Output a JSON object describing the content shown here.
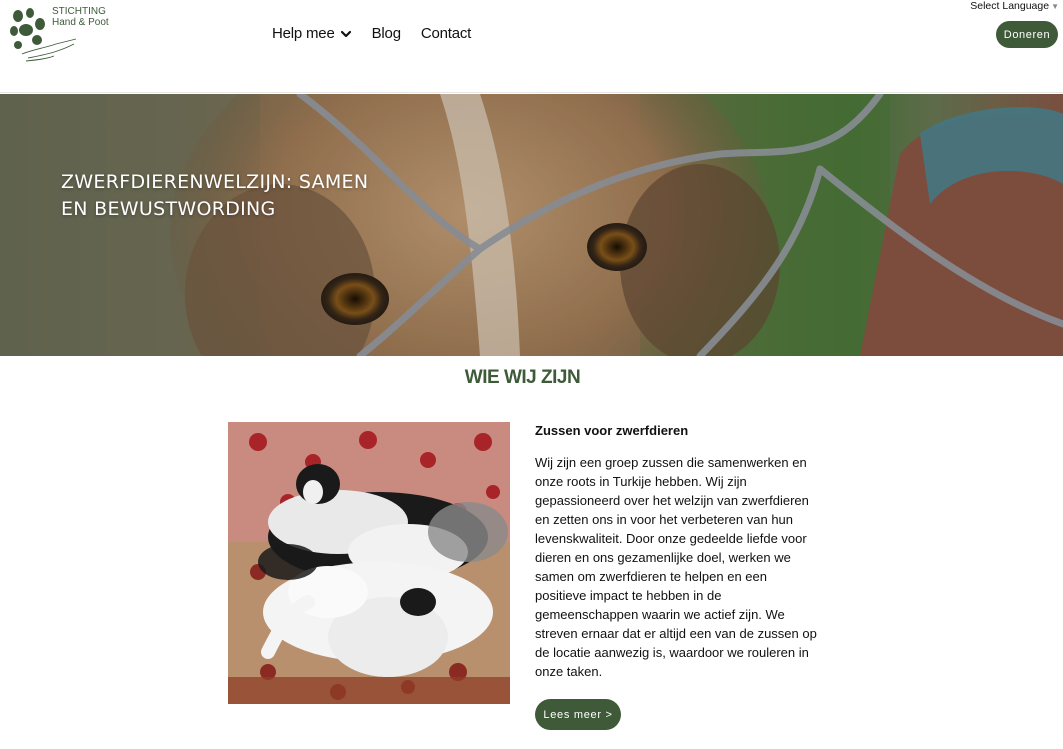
{
  "header": {
    "logo_line1": "STICHTING",
    "logo_line2": "Hand & Poot",
    "nav": [
      {
        "label": "Help mee",
        "has_dropdown": true
      },
      {
        "label": "Blog"
      },
      {
        "label": "Contact"
      }
    ],
    "language_select": "Select Language",
    "donate_label": "Doneren"
  },
  "hero": {
    "title": "ZWERFDIERENWELZIJN: SAMEN EN BEWUSTWORDING"
  },
  "about": {
    "section_title": "WIE WIJ ZIJN",
    "subheading": "Zussen voor zwerfdieren",
    "body": "Wij zijn een groep zussen die samenwerken en onze roots in Turkije hebben. Wij zijn gepassioneerd over het welzijn van zwerfdieren en zetten ons in voor het verbeteren van hun levenskwaliteit. Door onze gedeelde liefde voor dieren en ons gezamenlijke doel, werken we samen om zwerfdieren te helpen en een positieve impact te hebben in de gemeenschappen waarin we actief zijn. We streven ernaar dat er altijd een van de zussen op de locatie aanwezig is, waardoor we rouleren in onze taken.",
    "more_label": "Lees meer >"
  },
  "colors": {
    "brand_green": "#3e5a38"
  }
}
